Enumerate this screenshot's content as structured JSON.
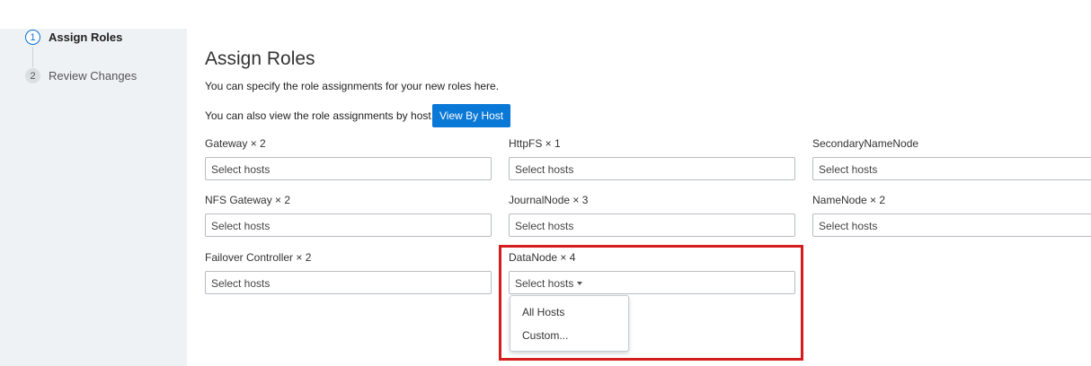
{
  "wizard": {
    "steps": [
      {
        "num": "1",
        "label": "Assign Roles",
        "active": true
      },
      {
        "num": "2",
        "label": "Review Changes",
        "active": false
      }
    ]
  },
  "main": {
    "title": "Assign Roles",
    "desc1": "You can specify the role assignments for your new roles here.",
    "desc2": "You can also view the role assignments by host.",
    "view_by_host_label": "View By Host",
    "roles": [
      {
        "label": "Gateway × 2",
        "value": "Select hosts"
      },
      {
        "label": "HttpFS × 1",
        "value": "Select hosts"
      },
      {
        "label": "SecondaryNameNode",
        "value": "Select hosts"
      },
      {
        "label": "NFS Gateway × 2",
        "value": "Select hosts"
      },
      {
        "label": "JournalNode × 3",
        "value": "Select hosts"
      },
      {
        "label": "NameNode × 2",
        "value": "Select hosts"
      },
      {
        "label": "Failover Controller × 2",
        "value": "Select hosts"
      },
      {
        "label": "DataNode × 4",
        "value": "Select hosts"
      }
    ],
    "datanode_dropdown": {
      "options": [
        "All Hosts",
        "Custom..."
      ]
    }
  },
  "colors": {
    "accent": "#0a78d6",
    "highlight": "#d61d1d",
    "sidebar_bg": "#eef2f4"
  }
}
